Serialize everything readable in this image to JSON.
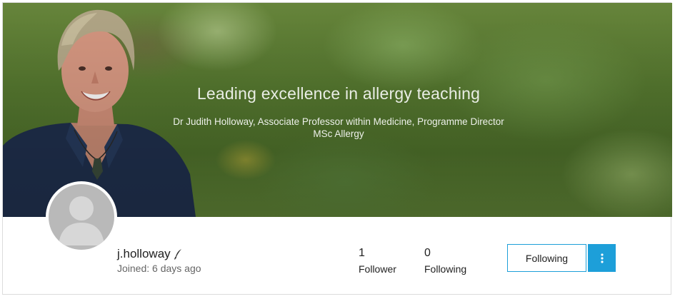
{
  "banner": {
    "headline": "Leading excellence in allergy teaching",
    "subtitle": "Dr Judith Holloway, Associate Professor within Medicine, Programme Director MSc Allergy"
  },
  "profile": {
    "username": "j.holloway",
    "joined": "Joined: 6 days ago",
    "badge_icon": "quill-icon"
  },
  "stats": {
    "followers": {
      "count": "1",
      "label": "Follower"
    },
    "following": {
      "count": "0",
      "label": "Following"
    }
  },
  "actions": {
    "follow_label": "Following",
    "more_icon": "kebab-menu-icon"
  },
  "colors": {
    "accent": "#1d9fd9",
    "avatar_placeholder": "#b9b9b9"
  }
}
